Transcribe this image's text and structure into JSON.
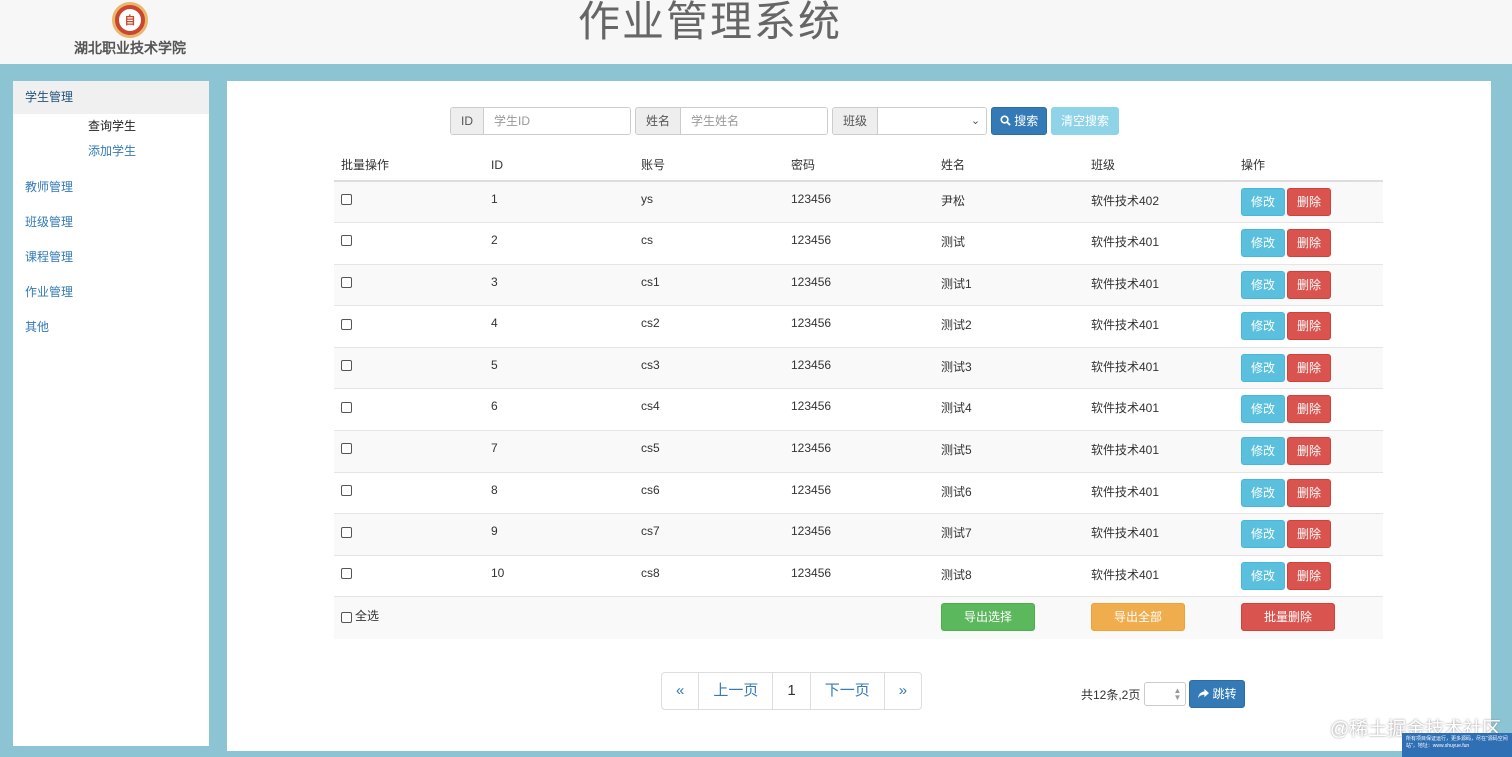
{
  "header": {
    "logo_text": "自",
    "school_name": "湖北职业技术学院",
    "app_title": "作业管理系统"
  },
  "sidebar": {
    "groups": [
      {
        "label": "学生管理",
        "subitems": [
          "查询学生",
          "添加学生"
        ]
      }
    ],
    "items": [
      "教师管理",
      "班级管理",
      "课程管理",
      "作业管理",
      "其他"
    ]
  },
  "search": {
    "id_label": "ID",
    "id_placeholder": "学生ID",
    "name_label": "姓名",
    "name_placeholder": "学生姓名",
    "class_label": "班级",
    "class_value": "",
    "search_label": "搜索",
    "clear_label": "清空搜索"
  },
  "table": {
    "columns": [
      "批量操作",
      "ID",
      "账号",
      "密码",
      "姓名",
      "班级",
      "操作"
    ],
    "rows": [
      {
        "id": "1",
        "account": "ys",
        "password": "123456",
        "name": "尹松",
        "class": "软件技术402"
      },
      {
        "id": "2",
        "account": "cs",
        "password": "123456",
        "name": "测试",
        "class": "软件技术401"
      },
      {
        "id": "3",
        "account": "cs1",
        "password": "123456",
        "name": "测试1",
        "class": "软件技术401"
      },
      {
        "id": "4",
        "account": "cs2",
        "password": "123456",
        "name": "测试2",
        "class": "软件技术401"
      },
      {
        "id": "5",
        "account": "cs3",
        "password": "123456",
        "name": "测试3",
        "class": "软件技术401"
      },
      {
        "id": "6",
        "account": "cs4",
        "password": "123456",
        "name": "测试4",
        "class": "软件技术401"
      },
      {
        "id": "7",
        "account": "cs5",
        "password": "123456",
        "name": "测试5",
        "class": "软件技术401"
      },
      {
        "id": "8",
        "account": "cs6",
        "password": "123456",
        "name": "测试6",
        "class": "软件技术401"
      },
      {
        "id": "9",
        "account": "cs7",
        "password": "123456",
        "name": "测试7",
        "class": "软件技术401"
      },
      {
        "id": "10",
        "account": "cs8",
        "password": "123456",
        "name": "测试8",
        "class": "软件技术401"
      }
    ],
    "edit_label": "修改",
    "delete_label": "删除",
    "select_all_label": "全选",
    "export_selected_label": "导出选择",
    "export_all_label": "导出全部",
    "batch_delete_label": "批量删除"
  },
  "pagination": {
    "first": "«",
    "prev": "上一页",
    "current": "1",
    "next": "下一页",
    "last": "»",
    "total_text": "共12条,2页",
    "jump_label": "跳转"
  },
  "watermark": {
    "text": "@稀土掘金技术社区",
    "box_text": "所有项目保证运行，更多源码，尽在\"源码空间站\"，地址：www.shuyue.fun"
  },
  "colors": {
    "primary": "#337ab7",
    "info": "#5bc0de",
    "danger": "#d9534f",
    "success": "#5cb85c",
    "warning": "#f0ad4e",
    "frame": "#8cc4d4"
  },
  "icons": {
    "search": "search-icon",
    "jump": "share-arrow-icon"
  }
}
